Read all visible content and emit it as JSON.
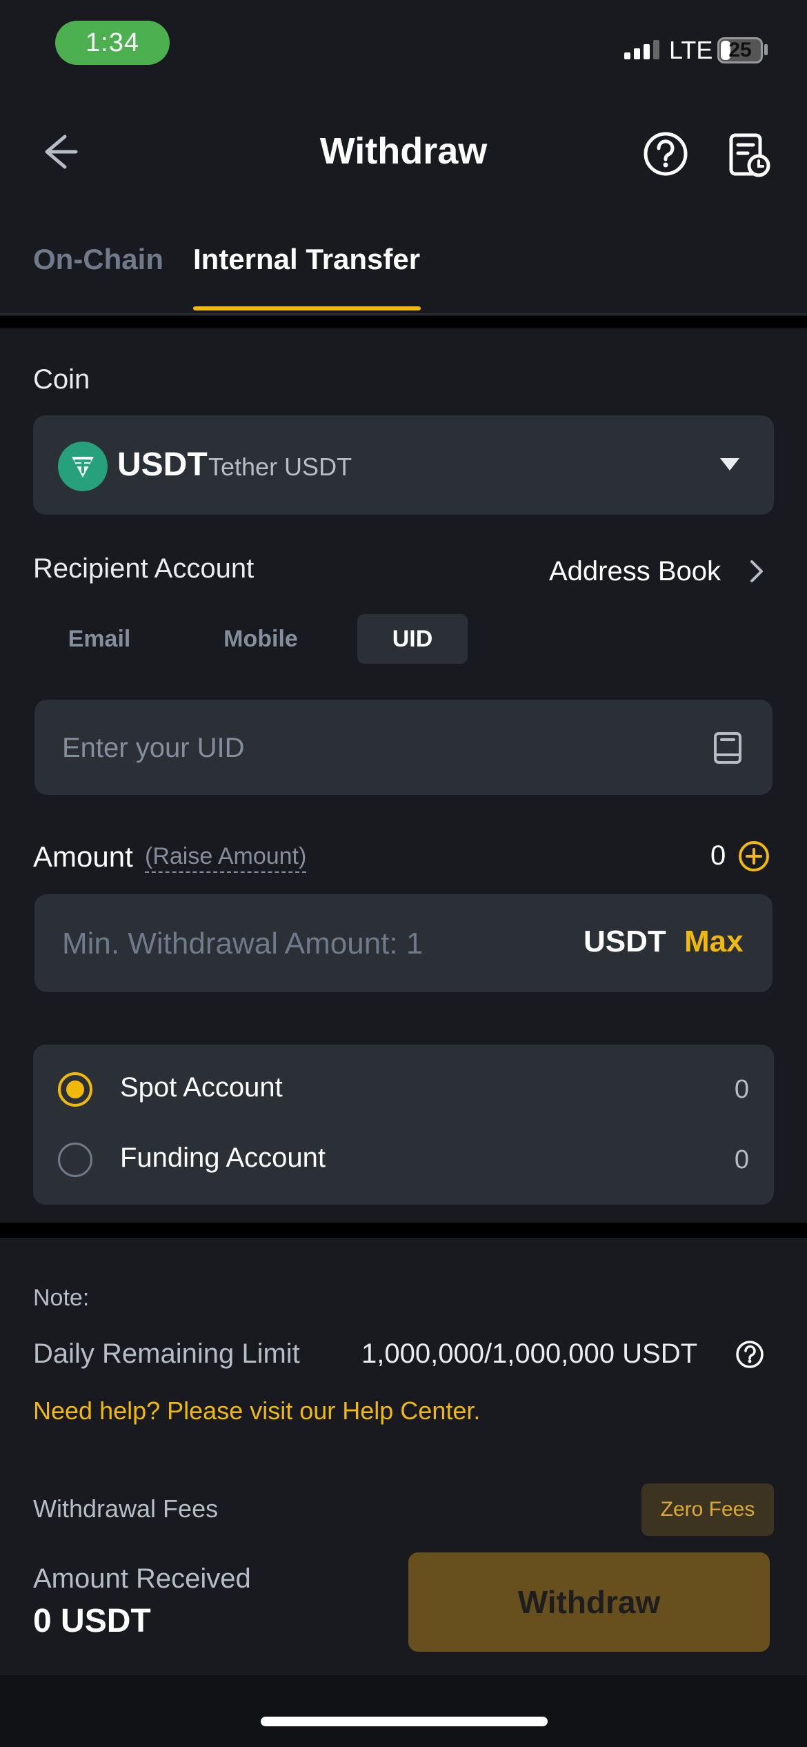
{
  "status_bar": {
    "time": "1:34",
    "network": "LTE",
    "battery": "25"
  },
  "header": {
    "title": "Withdraw",
    "back_icon": "arrow-left-icon",
    "help_icon": "question-circle-icon",
    "history_icon": "history-record-icon"
  },
  "tabs": [
    {
      "label": "On-Chain",
      "active": false
    },
    {
      "label": "Internal Transfer",
      "active": true
    }
  ],
  "coin": {
    "label": "Coin",
    "symbol": "USDT",
    "name": "Tether USDT",
    "icon": "tether-icon",
    "icon_color": "#26a17b"
  },
  "recipient": {
    "label": "Recipient Account",
    "address_book": "Address Book",
    "methods": [
      {
        "label": "Email",
        "selected": false
      },
      {
        "label": "Mobile",
        "selected": false
      },
      {
        "label": "UID",
        "selected": true
      }
    ],
    "input_placeholder": "Enter your UID",
    "input_value": ""
  },
  "amount": {
    "label": "Amount",
    "raise": "(Raise Amount)",
    "available": "0",
    "input_placeholder": "Min. Withdrawal Amount: 1",
    "input_value": "",
    "unit": "USDT",
    "max": "Max"
  },
  "accounts": [
    {
      "name": "Spot Account",
      "balance": "0",
      "selected": true
    },
    {
      "name": "Funding Account",
      "balance": "0",
      "selected": false
    }
  ],
  "note": {
    "heading": "Note:",
    "limit_label": "Daily Remaining Limit",
    "limit_value": "1,000,000/1,000,000 USDT",
    "help_text": "Need help? Please visit our Help Center."
  },
  "footer": {
    "fees_label": "Withdrawal Fees",
    "fees_badge": "Zero Fees",
    "received_label": "Amount Received",
    "received_value": "0 USDT",
    "withdraw_button": "Withdraw"
  },
  "colors": {
    "accent": "#f0b90b",
    "background": "#181a20",
    "card": "#2b2f36",
    "text_muted": "#848e9c"
  }
}
